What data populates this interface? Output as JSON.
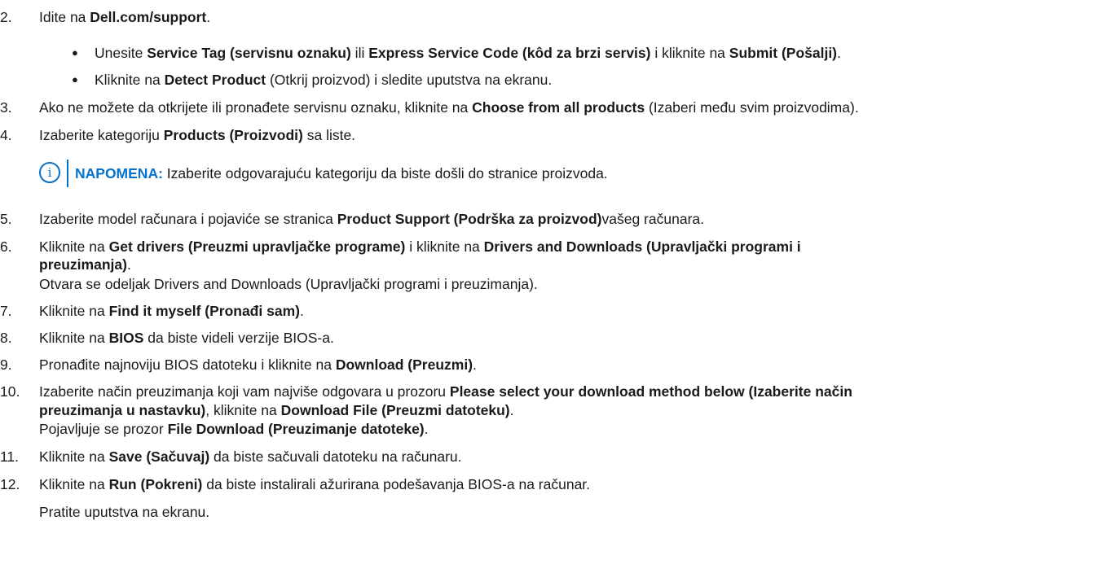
{
  "steps": [
    {
      "num": "2.",
      "pre": "Idite na ",
      "b1": "Dell.com/support",
      "post": "."
    },
    {
      "num": "3.",
      "pre": "Ako ne možete da otkrijete ili pronađete servisnu oznaku, kliknite na ",
      "b1": "Choose from all products",
      "post": " (Izaberi među svim proizvodima)."
    },
    {
      "num": "4.",
      "pre": "Izaberite kategoriju ",
      "b1": "Products (Proizvodi)",
      "post": " sa liste."
    },
    {
      "num": "5.",
      "pre": "Izaberite model računara i pojaviće se stranica ",
      "b1": "Product Support (Podrška za proizvod)",
      "post": "vašeg računara."
    },
    {
      "num": "6.",
      "pre": "Kliknite na ",
      "b1": "Get drivers (Preuzmi upravljačke programe)",
      "mid": " i kliknite na ",
      "b2": "Drivers and Downloads (Upravljački programi i",
      "b2cont": "preuzimanja)",
      "post": ".",
      "extra": "Otvara se odeljak Drivers and Downloads (Upravljački programi i preuzimanja)."
    },
    {
      "num": "7.",
      "pre": "Kliknite na ",
      "b1": "Find it myself (Pronađi sam)",
      "post": "."
    },
    {
      "num": "8.",
      "pre": "Kliknite na ",
      "b1": "BIOS",
      "post": " da biste videli verzije BIOS-a."
    },
    {
      "num": "9.",
      "pre": "Pronađite najnoviju BIOS datoteku i kliknite na ",
      "b1": "Download (Preuzmi)",
      "post": "."
    },
    {
      "num": "10.",
      "pre": "Izaberite način preuzimanja koji vam najviše odgovara u prozoru ",
      "b1": "Please select your download method below (Izaberite način",
      "b1cont": "preuzimanja u nastavku)",
      "mid": ", kliknite na ",
      "b2": "Download File (Preuzmi datoteku)",
      "post": ".",
      "extra_pre": "Pojavljuje se prozor ",
      "extra_b": "File Download (Preuzimanje datoteke)",
      "extra_post": "."
    },
    {
      "num": "11.",
      "pre": "Kliknite na ",
      "b1": "Save (Sačuvaj)",
      "post": " da biste sačuvali datoteku na računaru."
    },
    {
      "num": "12.",
      "pre": "Kliknite na ",
      "b1": "Run (Pokreni)",
      "post": " da biste instalirali ažurirana podešavanja BIOS-a na računar.",
      "extra": "Pratite uputstva na ekranu."
    }
  ],
  "bullets": [
    {
      "pre": "Unesite ",
      "b1": "Service Tag (servisnu oznaku)",
      "mid1": " ili ",
      "b2": "Express Service Code (kôd za brzi servis)",
      "mid2": " i kliknite na ",
      "b3": "Submit (Pošalji)",
      "post": "."
    },
    {
      "pre": "Kliknite na ",
      "b1": "Detect Product",
      "post": " (Otkrij proizvod) i sledite uputstva na ekranu."
    }
  ],
  "bullet_glyph": "●",
  "note": {
    "icon_glyph": "i",
    "label": "NAPOMENA:",
    "text": " Izaberite odgovarajuću kategoriju da biste došli do stranice proizvoda."
  },
  "colors": {
    "accent": "#0672cb",
    "text": "#1a1a1a"
  }
}
